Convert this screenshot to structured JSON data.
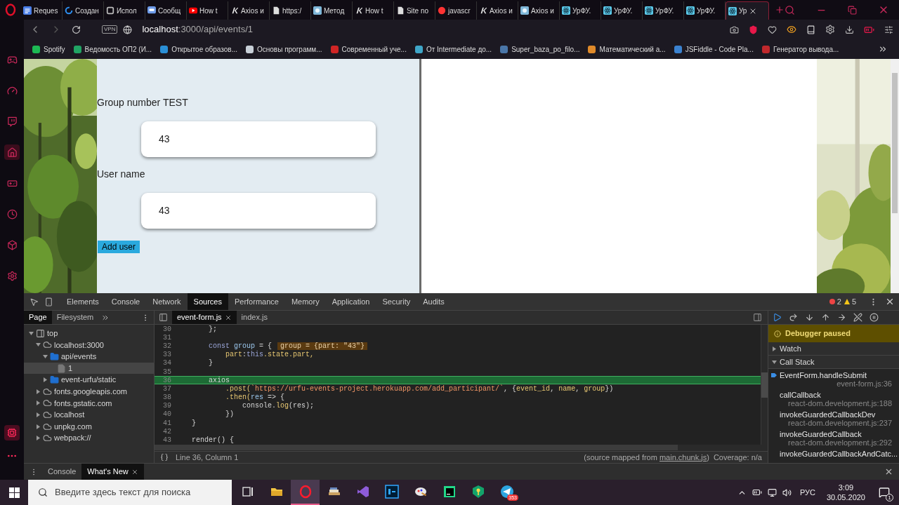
{
  "browser_tabs": [
    {
      "title": "Reques",
      "kind": "list",
      "selected": false
    },
    {
      "title": "Создан",
      "kind": "sync",
      "selected": false
    },
    {
      "title": "Испол",
      "kind": "square",
      "selected": false
    },
    {
      "title": "Сообщ",
      "kind": "chat",
      "selected": false
    },
    {
      "title": "How t",
      "kind": "video",
      "selected": false
    },
    {
      "title": "Axios и",
      "kind": "mark",
      "selected": false
    },
    {
      "title": "https:/",
      "kind": "page",
      "selected": false
    },
    {
      "title": "Метод",
      "selected": false
    },
    {
      "title": "How t",
      "kind": "mark",
      "selected": false
    },
    {
      "title": "Site no",
      "kind": "page",
      "selected": false
    },
    {
      "title": "javascr",
      "kind": "search",
      "selected": false
    },
    {
      "title": "Axios и",
      "kind": "mark",
      "selected": false
    },
    {
      "title": "Axios и",
      "selected": false
    },
    {
      "title": "УрФУ.",
      "kind": "react",
      "selected": false
    },
    {
      "title": "УрФУ.",
      "kind": "react",
      "selected": false
    },
    {
      "title": "УрФУ.",
      "kind": "react",
      "selected": false
    },
    {
      "title": "УрФУ.",
      "kind": "react",
      "selected": false
    },
    {
      "title": "Ур",
      "kind": "react",
      "selected": true
    }
  ],
  "address_bar": {
    "vpn": "VPN",
    "host": "localhost",
    "path": ":3000/api/events/1"
  },
  "bookmarks": [
    {
      "label": "Spotify",
      "color": "#1db954"
    },
    {
      "label": "Ведомость ОП2 (И...",
      "color": "#21a464"
    },
    {
      "label": "Открытое образов...",
      "color": "#2a8fd6"
    },
    {
      "label": "Основы программ...",
      "color": "#c8d0d8"
    },
    {
      "label": "Современный уче...",
      "color": "#d02525"
    },
    {
      "label": "От Intermediate до...",
      "color": "#3fa6c8"
    },
    {
      "label": "Super_baza_po_filo...",
      "color": "#4a76a8"
    },
    {
      "label": "Математический а...",
      "color": "#e08a2a"
    },
    {
      "label": "JSFiddle - Code Pla...",
      "color": "#3b82d0"
    },
    {
      "label": "Генератор вывода...",
      "color": "#c0282c"
    }
  ],
  "sidebar": [
    {
      "kind": "gamepad",
      "selected": false
    },
    {
      "kind": "gauge",
      "selected": false
    },
    {
      "kind": "twitch",
      "selected": false
    },
    {
      "kind": "home",
      "selected": true
    },
    {
      "kind": "controller",
      "selected": false
    },
    {
      "kind": "clock",
      "selected": false
    },
    {
      "kind": "cube",
      "selected": false
    },
    {
      "kind": "settings",
      "selected": false
    }
  ],
  "form": {
    "fields": [
      {
        "label": "Group number TEST",
        "value": "43"
      },
      {
        "label": "User name",
        "value": "43"
      }
    ],
    "submit": "Add user"
  },
  "devtools": {
    "tabs": [
      {
        "label": "Elements",
        "selected": false
      },
      {
        "label": "Console",
        "selected": false
      },
      {
        "label": "Network",
        "selected": false
      },
      {
        "label": "Sources",
        "selected": true
      },
      {
        "label": "Performance",
        "selected": false
      },
      {
        "label": "Memory",
        "selected": false
      },
      {
        "label": "Application",
        "selected": false
      },
      {
        "label": "Security",
        "selected": false
      },
      {
        "label": "Audits",
        "selected": false
      }
    ],
    "errors": "2",
    "warnings": "5"
  },
  "navigator": {
    "tabs": [
      {
        "label": "Page",
        "selected": true
      },
      {
        "label": "Filesystem",
        "selected": false
      }
    ],
    "tree": [
      {
        "label": "top",
        "kind": "frame",
        "expanded": true,
        "selected": false,
        "children": [
          {
            "label": "localhost:3000",
            "kind": "domain",
            "expanded": true,
            "selected": false,
            "children": [
              {
                "label": "api/events",
                "kind": "folder",
                "expanded": true,
                "selected": false,
                "children": [
                  {
                    "label": "1",
                    "kind": "file",
                    "selected": true
                  }
                ]
              },
              {
                "label": "event-urfu/static",
                "kind": "folder",
                "expanded": false,
                "selected": false
              }
            ]
          },
          {
            "label": "fonts.googleapis.com",
            "kind": "domain",
            "expanded": false,
            "selected": false
          },
          {
            "label": "fonts.gstatic.com",
            "kind": "domain",
            "expanded": false,
            "selected": false
          },
          {
            "label": "localhost",
            "kind": "domain",
            "expanded": false,
            "selected": false
          },
          {
            "label": "unpkg.com",
            "kind": "domain",
            "expanded": false,
            "selected": false
          },
          {
            "label": "webpack://",
            "kind": "domain",
            "expanded": false,
            "selected": false
          }
        ]
      }
    ]
  },
  "editor": {
    "tabs": [
      {
        "label": "event-form.js",
        "selected": true,
        "closable": true
      },
      {
        "label": "index.js",
        "selected": false,
        "closable": false
      }
    ],
    "lines": [
      {
        "number": "30",
        "current": false,
        "tokens": [
          {
            "text": "        };",
            "kind": "plain"
          }
        ]
      },
      {
        "number": "31",
        "current": false
      },
      {
        "number": "32",
        "current": false,
        "tokens": [
          {
            "text": "        const",
            "kind": "keyword"
          },
          {
            "text": " group",
            "kind": "variable"
          },
          {
            "text": " = {",
            "kind": "plain"
          },
          {
            "text": "group = {part: \"43\"}",
            "kind": "inline"
          }
        ]
      },
      {
        "number": "33",
        "current": false,
        "tokens": [
          {
            "text": "            part",
            "kind": "property"
          },
          {
            "text": ":",
            "kind": "plain"
          },
          {
            "text": "this",
            "kind": "keyword"
          },
          {
            "text": ".state.part,",
            "kind": "property"
          }
        ]
      },
      {
        "number": "34",
        "current": false,
        "tokens": [
          {
            "text": "        }",
            "kind": "plain"
          }
        ]
      },
      {
        "number": "35",
        "current": false
      },
      {
        "number": "36",
        "current": true,
        "tokens": [
          {
            "text": "        axios",
            "kind": "plain"
          }
        ]
      },
      {
        "number": "37",
        "current": false,
        "tokens": [
          {
            "text": "            .post(",
            "kind": "property"
          },
          {
            "text": "`https://urfu-events-project.herokuapp.com/add_participant/`",
            "kind": "string"
          },
          {
            "text": ", {",
            "kind": "plain"
          },
          {
            "text": "event_id",
            "kind": "property"
          },
          {
            "text": ", ",
            "kind": "plain"
          },
          {
            "text": "name",
            "kind": "property"
          },
          {
            "text": ", ",
            "kind": "plain"
          },
          {
            "text": "group",
            "kind": "property"
          },
          {
            "text": "})",
            "kind": "plain"
          }
        ]
      },
      {
        "number": "38",
        "current": false,
        "tokens": [
          {
            "text": "            .then(",
            "kind": "property"
          },
          {
            "text": "res",
            "kind": "variable"
          },
          {
            "text": " => {",
            "kind": "plain"
          }
        ]
      },
      {
        "number": "39",
        "current": false,
        "tokens": [
          {
            "text": "                console.",
            "kind": "plain"
          },
          {
            "text": "log",
            "kind": "property"
          },
          {
            "text": "(res);",
            "kind": "plain"
          }
        ]
      },
      {
        "number": "40",
        "current": false,
        "tokens": [
          {
            "text": "            })",
            "kind": "plain"
          }
        ]
      },
      {
        "number": "41",
        "current": false,
        "tokens": [
          {
            "text": "    }",
            "kind": "plain"
          }
        ]
      },
      {
        "number": "42",
        "current": false
      },
      {
        "number": "43",
        "current": false,
        "tokens": [
          {
            "text": "    render() {",
            "kind": "plain"
          }
        ]
      }
    ],
    "status": {
      "position": "Line 36, Column 1",
      "source_prefix": "(source mapped from ",
      "source_link": "main.chunk.js",
      "source_suffix": ")",
      "coverage": "Coverage: n/a"
    }
  },
  "debugger": {
    "banner": "Debugger paused",
    "sections": [
      {
        "label": "Watch",
        "expanded": false
      },
      {
        "label": "Call Stack",
        "expanded": true
      }
    ],
    "call_stack": [
      {
        "name": "EventForm.handleSubmit",
        "location": "event-form.js:36",
        "selected": true
      },
      {
        "name": "callCallback",
        "location": "react-dom.development.js:188",
        "selected": false
      },
      {
        "name": "invokeGuardedCallbackDev",
        "location": "react-dom.development.js:237",
        "selected": false
      },
      {
        "name": "invokeGuardedCallback",
        "location": "react-dom.development.js:292",
        "selected": false
      },
      {
        "name": "invokeGuardedCallbackAndCatc...",
        "selected": false
      }
    ]
  },
  "drawer": {
    "tabs": [
      {
        "label": "Console",
        "selected": false,
        "closable": false
      },
      {
        "label": "What's New",
        "selected": true,
        "closable": true
      }
    ]
  },
  "taskbar": {
    "search_placeholder": "Введите здесь текст для поиска",
    "apps": [
      {
        "kind": "taskview",
        "active": false
      },
      {
        "kind": "folder",
        "active": false
      },
      {
        "kind": "opera",
        "active": true
      },
      {
        "kind": "books",
        "active": false
      },
      {
        "kind": "vs",
        "active": false
      },
      {
        "kind": "ps",
        "active": false
      },
      {
        "kind": "paint",
        "active": false
      },
      {
        "kind": "ws",
        "active": false
      },
      {
        "kind": "key",
        "active": false
      },
      {
        "kind": "telegram",
        "active": false,
        "badge": "353"
      }
    ],
    "language": "РУС",
    "time": "3:09",
    "date": "30.05.2020",
    "notifications": "1"
  }
}
